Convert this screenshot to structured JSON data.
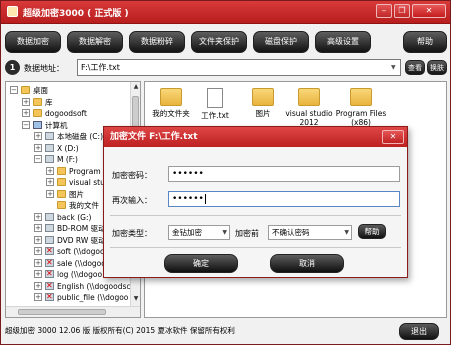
{
  "window": {
    "title": "超级加密3000 ( 正式版 )",
    "controls": {
      "minimize": "–",
      "restore": "❐",
      "close": "✕"
    }
  },
  "toolbar": {
    "buttons": [
      "数据加密",
      "数据解密",
      "数据粉碎",
      "文件夹保护",
      "磁盘保护",
      "高级设置",
      "帮助"
    ]
  },
  "address": {
    "step": "1",
    "label": "数据地址：",
    "value": "F:\\工作.txt",
    "view_button": "查看",
    "swap_button": "换肤"
  },
  "tree": {
    "items": [
      {
        "label": "桌面",
        "icon": "folder-icon",
        "expander": "−"
      },
      {
        "label": "库",
        "icon": "folder-icon",
        "expander": "+"
      },
      {
        "label": "dogoodsoft",
        "icon": "folder-icon",
        "expander": "+"
      },
      {
        "label": "计算机",
        "icon": "computer-icon",
        "expander": "−"
      },
      {
        "label": "本地磁盘 (C:)",
        "icon": "drive-icon",
        "expander": "+"
      },
      {
        "label": "X (D:)",
        "icon": "drive-icon",
        "expander": "+"
      },
      {
        "label": "M (F:)",
        "icon": "drive-icon",
        "expander": "−"
      },
      {
        "label": "Program",
        "icon": "folder-icon",
        "expander": "+"
      },
      {
        "label": "visual studi",
        "icon": "folder-icon",
        "expander": "+"
      },
      {
        "label": "图片",
        "icon": "folder-icon",
        "expander": "+"
      },
      {
        "label": "我的文件",
        "icon": "folder-icon",
        "expander": ""
      },
      {
        "label": "back (G:)",
        "icon": "drive-icon",
        "expander": "+"
      },
      {
        "label": "BD-ROM 驱动",
        "icon": "drive-icon",
        "expander": "+"
      },
      {
        "label": "DVD RW 驱动",
        "icon": "drive-icon",
        "expander": "+"
      },
      {
        "label": "soft (\\\\dogoo",
        "icon": "network-drive-icon",
        "expander": "+"
      },
      {
        "label": "sale (\\\\dogoo",
        "icon": "network-drive-icon",
        "expander": "+"
      },
      {
        "label": "log (\\\\dogoo",
        "icon": "network-drive-icon",
        "expander": "+"
      },
      {
        "label": "English (\\\\dogoodsc",
        "icon": "network-drive-icon",
        "expander": "+"
      },
      {
        "label": "public_file (\\\\dogoo",
        "icon": "network-drive-icon",
        "expander": "+"
      }
    ]
  },
  "files": {
    "items": [
      {
        "label": "我的文件夹",
        "type": "folder"
      },
      {
        "label": "工作.txt",
        "type": "file"
      },
      {
        "label": "图片",
        "type": "folder"
      },
      {
        "label": "visual studio 2012",
        "type": "folder"
      },
      {
        "label": "Program Files (x86)",
        "type": "folder"
      }
    ]
  },
  "status": {
    "text": "超级加密 3000  12.06 版   版权所有(C) 2015 夏冰软件  保留所有权利",
    "exit_button": "退出"
  },
  "dialog": {
    "title": "加密文件 F:\\工作.txt",
    "close": "✕",
    "password_label": "加密密码：",
    "password_value": "••••••",
    "confirm_label": "再次输入：",
    "confirm_value": "••••••",
    "type_label": "加密类型：",
    "type_value": "金钻加密",
    "before_label": "加密前",
    "before_value": "不确认密码",
    "help_button": "帮助",
    "ok_button": "确定",
    "cancel_button": "取消"
  }
}
